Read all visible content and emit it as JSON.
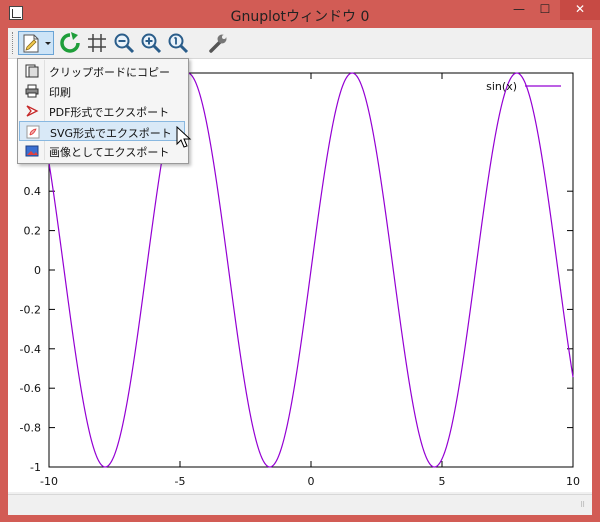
{
  "window": {
    "title": "Gnuplotウィンドウ 0",
    "controls": {
      "minimize": "—",
      "maximize": "☐",
      "close": "✕"
    }
  },
  "toolbar": {
    "buttons": [
      {
        "icon": "export-icon",
        "has_dropdown": true
      },
      {
        "icon": "replot-icon"
      },
      {
        "icon": "grid-icon"
      },
      {
        "icon": "zoom-out-icon"
      },
      {
        "icon": "zoom-in-icon"
      },
      {
        "icon": "zoom-reset-icon"
      },
      {
        "icon": "settings-wrench-icon"
      }
    ]
  },
  "export_menu": {
    "items": [
      {
        "label": "クリップボードにコピー",
        "icon": "copy-icon"
      },
      {
        "label": "印刷",
        "icon": "printer-icon"
      },
      {
        "label": "PDF形式でエクスポート",
        "icon": "pdf-icon"
      },
      {
        "label": "SVG形式でエクスポート",
        "icon": "svg-icon",
        "highlighted": true
      },
      {
        "label": "画像としてエクスポート",
        "icon": "image-icon"
      }
    ]
  },
  "chart_data": {
    "type": "line",
    "function": "sin(x)",
    "series": [
      {
        "name": "sin(x)",
        "color": "#9400d3"
      }
    ],
    "xlim": [
      -10,
      10
    ],
    "ylim": [
      -1,
      1
    ],
    "x_ticks": [
      "-10",
      "-5",
      "0",
      "5",
      "10"
    ],
    "y_ticks": [
      "0.4",
      "0.2",
      "0",
      "-0.2",
      "-0.4",
      "-0.6",
      "-0.8",
      "-1"
    ],
    "legend_position": "top-right",
    "title": "",
    "xlabel": "",
    "ylabel": ""
  }
}
